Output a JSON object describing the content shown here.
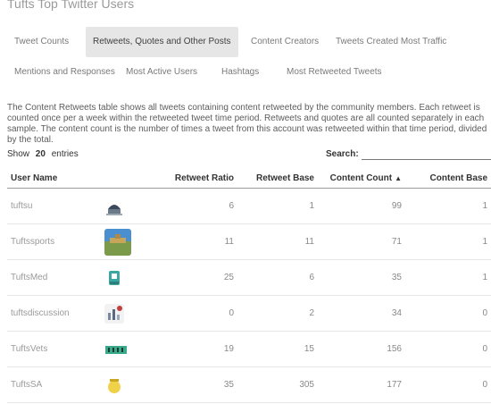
{
  "page": {
    "title": "Tufts Top Twitter Users"
  },
  "tabs": [
    {
      "label": "Tweet Counts"
    },
    {
      "label": "Retweets, Quotes and Other Posts"
    },
    {
      "label": "Content Creators"
    },
    {
      "label": "Tweets Created Most Traffic"
    },
    {
      "label": "Mentions and Responses"
    },
    {
      "label": "Most Active Users"
    },
    {
      "label": "Hashtags"
    },
    {
      "label": "Most Retweeted Tweets"
    }
  ],
  "active_tab": 1,
  "description": "The Content Retweets table shows all tweets containing content retweeted by the community members. Each retweet is counted once per a week within the retweeted tweet time period. Retweets and quotes are all counted separately in each sample. The content count is the number of times a tweet from this account was retweeted within that time period, divided by the total.",
  "controls": {
    "show_label": "Show",
    "show_value": "20",
    "entries_label": "entries",
    "search_label": "Search:",
    "search_value": "",
    "search_placeholder": ""
  },
  "table": {
    "columns": [
      "User Name",
      "",
      "Retweet Ratio",
      "Retweet Base",
      "Content Count",
      "Content Base"
    ],
    "sort_arrow": "▲",
    "rows": [
      {
        "user": "tuftsu",
        "avatar": "building-icon",
        "bw": "6",
        "bs": "1",
        "cc": "99",
        "cb": "1"
      },
      {
        "user": "Tuftssports",
        "avatar": "landscape-icon",
        "bw": "11",
        "bs": "11",
        "cc": "71",
        "cb": "1"
      },
      {
        "user": "TuftsMed",
        "avatar": "trophy-icon",
        "bw": "25",
        "bs": "6",
        "cc": "35",
        "cb": "1"
      },
      {
        "user": "tuftsdiscussion",
        "avatar": "stats-icon",
        "bw": "0",
        "bs": "2",
        "cc": "34",
        "cb": "0"
      },
      {
        "user": "TuftsVets",
        "avatar": "group-icon",
        "bw": "19",
        "bs": "15",
        "cc": "156",
        "cb": "0"
      },
      {
        "user": "TuftsSA",
        "avatar": "sun-icon",
        "bw": "35",
        "bs": "305",
        "cc": "177",
        "cb": "0"
      }
    ]
  },
  "colors": {
    "active_tab_bg": "#e6e6e6",
    "text_muted": "#888888"
  }
}
